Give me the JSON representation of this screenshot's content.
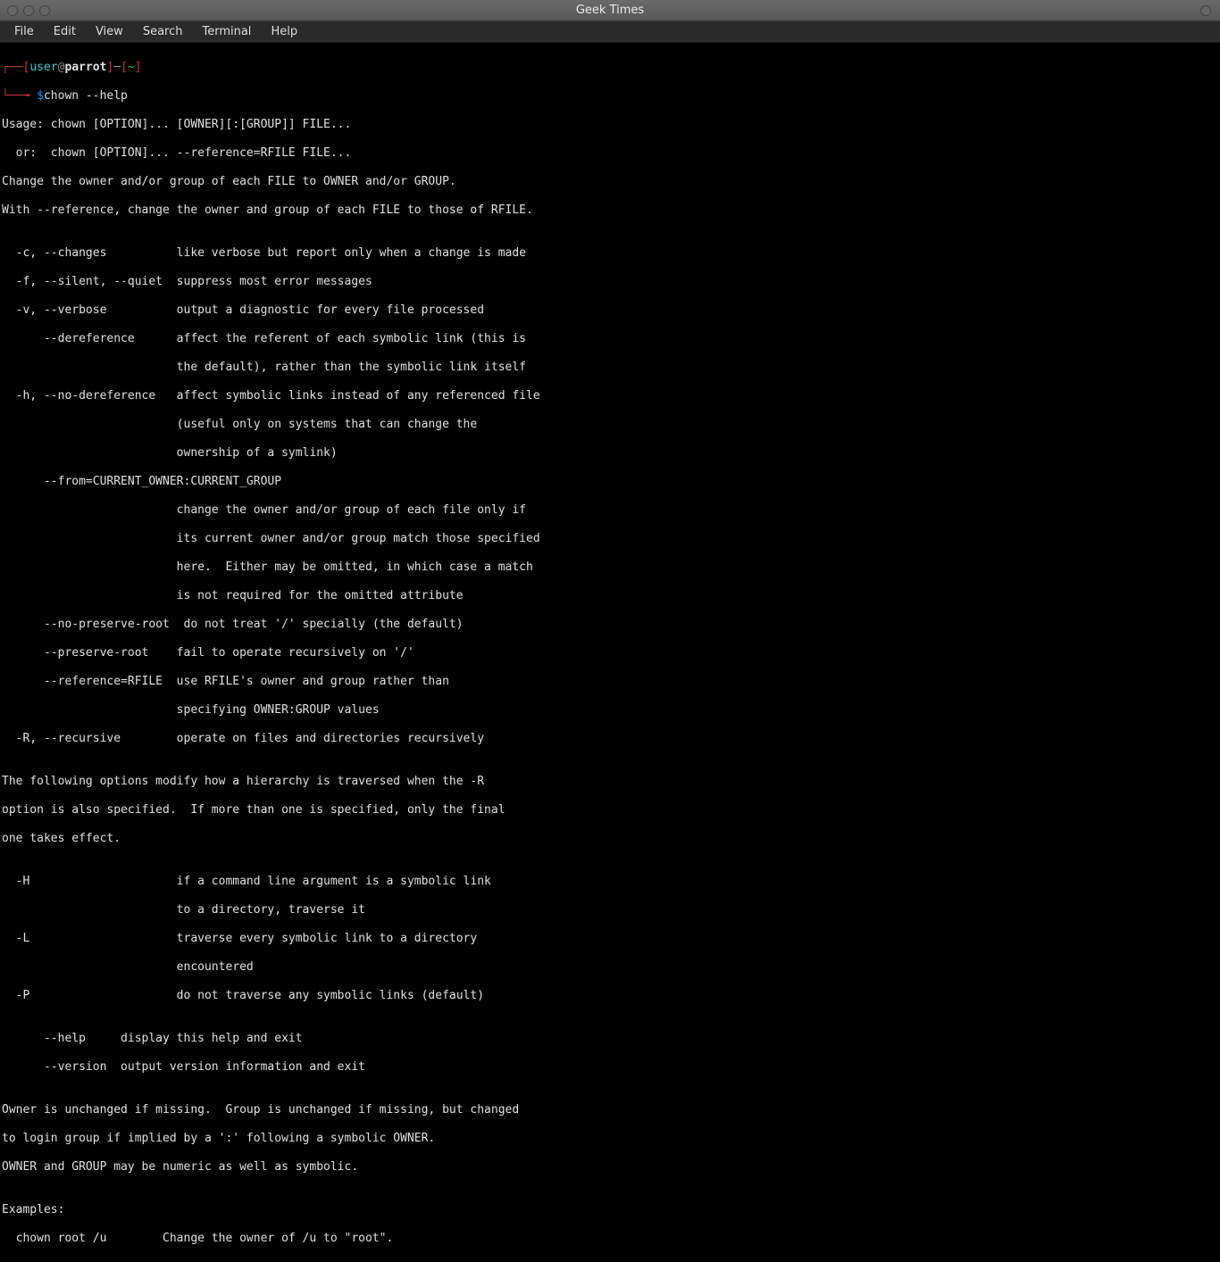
{
  "window": {
    "title": "Geek Times"
  },
  "menubar": {
    "file": "File",
    "edit": "Edit",
    "view": "View",
    "search": "Search",
    "terminal": "Terminal",
    "help": "Help"
  },
  "prompt": {
    "lbracket1": "┌──[",
    "user": "user",
    "at": "@",
    "host": "parrot",
    "rbracket1": "]",
    "dash": "─",
    "lbracket2": "[",
    "path": "~",
    "rbracket2": "]",
    "corner": "└──╼ ",
    "dollar": "$",
    "command": "chown --help"
  },
  "output": {
    "l00": "Usage: chown [OPTION]... [OWNER][:[GROUP]] FILE...",
    "l01": "  or:  chown [OPTION]... --reference=RFILE FILE...",
    "l02": "Change the owner and/or group of each FILE to OWNER and/or GROUP.",
    "l03": "With --reference, change the owner and group of each FILE to those of RFILE.",
    "l04": "",
    "l05": "  -c, --changes          like verbose but report only when a change is made",
    "l06": "  -f, --silent, --quiet  suppress most error messages",
    "l07": "  -v, --verbose          output a diagnostic for every file processed",
    "l08": "      --dereference      affect the referent of each symbolic link (this is",
    "l09": "                         the default), rather than the symbolic link itself",
    "l10": "  -h, --no-dereference   affect symbolic links instead of any referenced file",
    "l11": "                         (useful only on systems that can change the",
    "l12": "                         ownership of a symlink)",
    "l13": "      --from=CURRENT_OWNER:CURRENT_GROUP",
    "l14": "                         change the owner and/or group of each file only if",
    "l15": "                         its current owner and/or group match those specified",
    "l16": "                         here.  Either may be omitted, in which case a match",
    "l17": "                         is not required for the omitted attribute",
    "l18": "      --no-preserve-root  do not treat '/' specially (the default)",
    "l19": "      --preserve-root    fail to operate recursively on '/'",
    "l20": "      --reference=RFILE  use RFILE's owner and group rather than",
    "l21": "                         specifying OWNER:GROUP values",
    "l22": "  -R, --recursive        operate on files and directories recursively",
    "l23": "",
    "l24": "The following options modify how a hierarchy is traversed when the -R",
    "l25": "option is also specified.  If more than one is specified, only the final",
    "l26": "one takes effect.",
    "l27": "",
    "l28": "  -H                     if a command line argument is a symbolic link",
    "l29": "                         to a directory, traverse it",
    "l30": "  -L                     traverse every symbolic link to a directory",
    "l31": "                         encountered",
    "l32": "  -P                     do not traverse any symbolic links (default)",
    "l33": "",
    "l34": "      --help     display this help and exit",
    "l35": "      --version  output version information and exit",
    "l36": "",
    "l37": "Owner is unchanged if missing.  Group is unchanged if missing, but changed",
    "l38": "to login group if implied by a ':' following a symbolic OWNER.",
    "l39": "OWNER and GROUP may be numeric as well as symbolic.",
    "l40": "",
    "l41": "Examples:",
    "l42": "  chown root /u        Change the owner of /u to \"root\"."
  }
}
